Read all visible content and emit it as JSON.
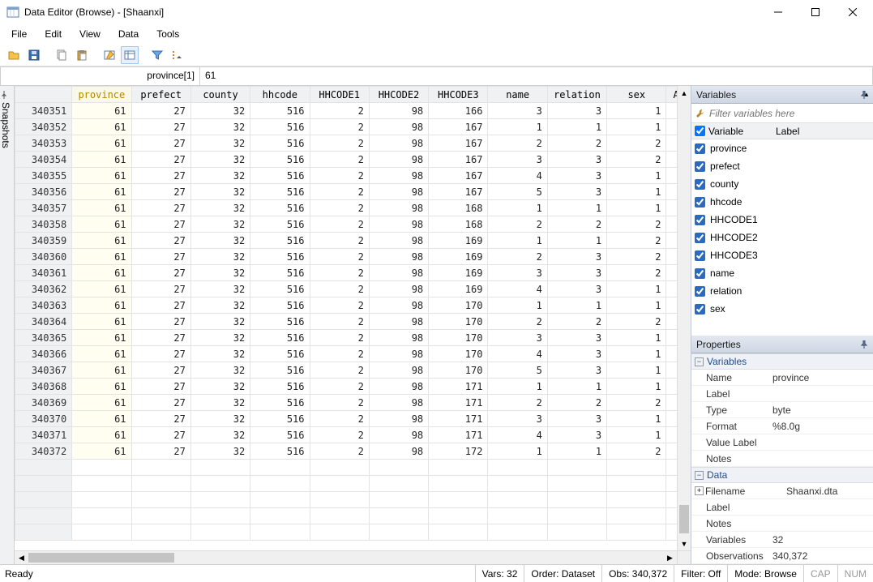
{
  "window": {
    "title": "Data Editor (Browse) - [Shaanxi]"
  },
  "menu": {
    "file": "File",
    "edit": "Edit",
    "view": "View",
    "data": "Data",
    "tools": "Tools"
  },
  "expr": {
    "cell": "province[1]",
    "value": "61"
  },
  "snapshots_label": "Snapshots",
  "columns": [
    "province",
    "prefect",
    "county",
    "hhcode",
    "HHCODE1",
    "HHCODE2",
    "HHCODE3",
    "name",
    "relation",
    "sex",
    "AG"
  ],
  "rows": [
    {
      "rn": "340351",
      "province": "61",
      "prefect": "27",
      "county": "32",
      "hhcode": "516",
      "HHCODE1": "2",
      "HHCODE2": "98",
      "HHCODE3": "166",
      "name": "3",
      "relation": "3",
      "sex": "1"
    },
    {
      "rn": "340352",
      "province": "61",
      "prefect": "27",
      "county": "32",
      "hhcode": "516",
      "HHCODE1": "2",
      "HHCODE2": "98",
      "HHCODE3": "167",
      "name": "1",
      "relation": "1",
      "sex": "1"
    },
    {
      "rn": "340353",
      "province": "61",
      "prefect": "27",
      "county": "32",
      "hhcode": "516",
      "HHCODE1": "2",
      "HHCODE2": "98",
      "HHCODE3": "167",
      "name": "2",
      "relation": "2",
      "sex": "2"
    },
    {
      "rn": "340354",
      "province": "61",
      "prefect": "27",
      "county": "32",
      "hhcode": "516",
      "HHCODE1": "2",
      "HHCODE2": "98",
      "HHCODE3": "167",
      "name": "3",
      "relation": "3",
      "sex": "2"
    },
    {
      "rn": "340355",
      "province": "61",
      "prefect": "27",
      "county": "32",
      "hhcode": "516",
      "HHCODE1": "2",
      "HHCODE2": "98",
      "HHCODE3": "167",
      "name": "4",
      "relation": "3",
      "sex": "1"
    },
    {
      "rn": "340356",
      "province": "61",
      "prefect": "27",
      "county": "32",
      "hhcode": "516",
      "HHCODE1": "2",
      "HHCODE2": "98",
      "HHCODE3": "167",
      "name": "5",
      "relation": "3",
      "sex": "1"
    },
    {
      "rn": "340357",
      "province": "61",
      "prefect": "27",
      "county": "32",
      "hhcode": "516",
      "HHCODE1": "2",
      "HHCODE2": "98",
      "HHCODE3": "168",
      "name": "1",
      "relation": "1",
      "sex": "1"
    },
    {
      "rn": "340358",
      "province": "61",
      "prefect": "27",
      "county": "32",
      "hhcode": "516",
      "HHCODE1": "2",
      "HHCODE2": "98",
      "HHCODE3": "168",
      "name": "2",
      "relation": "2",
      "sex": "2"
    },
    {
      "rn": "340359",
      "province": "61",
      "prefect": "27",
      "county": "32",
      "hhcode": "516",
      "HHCODE1": "2",
      "HHCODE2": "98",
      "HHCODE3": "169",
      "name": "1",
      "relation": "1",
      "sex": "2"
    },
    {
      "rn": "340360",
      "province": "61",
      "prefect": "27",
      "county": "32",
      "hhcode": "516",
      "HHCODE1": "2",
      "HHCODE2": "98",
      "HHCODE3": "169",
      "name": "2",
      "relation": "3",
      "sex": "2"
    },
    {
      "rn": "340361",
      "province": "61",
      "prefect": "27",
      "county": "32",
      "hhcode": "516",
      "HHCODE1": "2",
      "HHCODE2": "98",
      "HHCODE3": "169",
      "name": "3",
      "relation": "3",
      "sex": "2"
    },
    {
      "rn": "340362",
      "province": "61",
      "prefect": "27",
      "county": "32",
      "hhcode": "516",
      "HHCODE1": "2",
      "HHCODE2": "98",
      "HHCODE3": "169",
      "name": "4",
      "relation": "3",
      "sex": "1"
    },
    {
      "rn": "340363",
      "province": "61",
      "prefect": "27",
      "county": "32",
      "hhcode": "516",
      "HHCODE1": "2",
      "HHCODE2": "98",
      "HHCODE3": "170",
      "name": "1",
      "relation": "1",
      "sex": "1"
    },
    {
      "rn": "340364",
      "province": "61",
      "prefect": "27",
      "county": "32",
      "hhcode": "516",
      "HHCODE1": "2",
      "HHCODE2": "98",
      "HHCODE3": "170",
      "name": "2",
      "relation": "2",
      "sex": "2"
    },
    {
      "rn": "340365",
      "province": "61",
      "prefect": "27",
      "county": "32",
      "hhcode": "516",
      "HHCODE1": "2",
      "HHCODE2": "98",
      "HHCODE3": "170",
      "name": "3",
      "relation": "3",
      "sex": "1"
    },
    {
      "rn": "340366",
      "province": "61",
      "prefect": "27",
      "county": "32",
      "hhcode": "516",
      "HHCODE1": "2",
      "HHCODE2": "98",
      "HHCODE3": "170",
      "name": "4",
      "relation": "3",
      "sex": "1"
    },
    {
      "rn": "340367",
      "province": "61",
      "prefect": "27",
      "county": "32",
      "hhcode": "516",
      "HHCODE1": "2",
      "HHCODE2": "98",
      "HHCODE3": "170",
      "name": "5",
      "relation": "3",
      "sex": "1"
    },
    {
      "rn": "340368",
      "province": "61",
      "prefect": "27",
      "county": "32",
      "hhcode": "516",
      "HHCODE1": "2",
      "HHCODE2": "98",
      "HHCODE3": "171",
      "name": "1",
      "relation": "1",
      "sex": "1"
    },
    {
      "rn": "340369",
      "province": "61",
      "prefect": "27",
      "county": "32",
      "hhcode": "516",
      "HHCODE1": "2",
      "HHCODE2": "98",
      "HHCODE3": "171",
      "name": "2",
      "relation": "2",
      "sex": "2"
    },
    {
      "rn": "340370",
      "province": "61",
      "prefect": "27",
      "county": "32",
      "hhcode": "516",
      "HHCODE1": "2",
      "HHCODE2": "98",
      "HHCODE3": "171",
      "name": "3",
      "relation": "3",
      "sex": "1"
    },
    {
      "rn": "340371",
      "province": "61",
      "prefect": "27",
      "county": "32",
      "hhcode": "516",
      "HHCODE1": "2",
      "HHCODE2": "98",
      "HHCODE3": "171",
      "name": "4",
      "relation": "3",
      "sex": "1"
    },
    {
      "rn": "340372",
      "province": "61",
      "prefect": "27",
      "county": "32",
      "hhcode": "516",
      "HHCODE1": "2",
      "HHCODE2": "98",
      "HHCODE3": "172",
      "name": "1",
      "relation": "1",
      "sex": "2"
    }
  ],
  "variables_panel": {
    "title": "Variables",
    "filter_placeholder": "Filter variables here",
    "header": {
      "col1": "Variable",
      "col2": "Label"
    },
    "items": [
      "province",
      "prefect",
      "county",
      "hhcode",
      "HHCODE1",
      "HHCODE2",
      "HHCODE3",
      "name",
      "relation",
      "sex"
    ]
  },
  "properties_panel": {
    "title": "Properties",
    "group_variables": "Variables",
    "rows_var": [
      {
        "label": "Name",
        "value": "province"
      },
      {
        "label": "Label",
        "value": ""
      },
      {
        "label": "Type",
        "value": "byte"
      },
      {
        "label": "Format",
        "value": "%8.0g"
      },
      {
        "label": "Value Label",
        "value": ""
      },
      {
        "label": "Notes",
        "value": ""
      }
    ],
    "group_data": "Data",
    "rows_data": [
      {
        "label": "Filename",
        "value": "Shaanxi.dta"
      },
      {
        "label": "Label",
        "value": ""
      },
      {
        "label": "Notes",
        "value": ""
      },
      {
        "label": "Variables",
        "value": "32"
      },
      {
        "label": "Observations",
        "value": "340,372"
      }
    ]
  },
  "status": {
    "ready": "Ready",
    "vars": "Vars: 32",
    "order": "Order: Dataset",
    "obs": "Obs: 340,372",
    "filter": "Filter: Off",
    "mode": "Mode: Browse",
    "cap": "CAP",
    "num": "NUM"
  }
}
